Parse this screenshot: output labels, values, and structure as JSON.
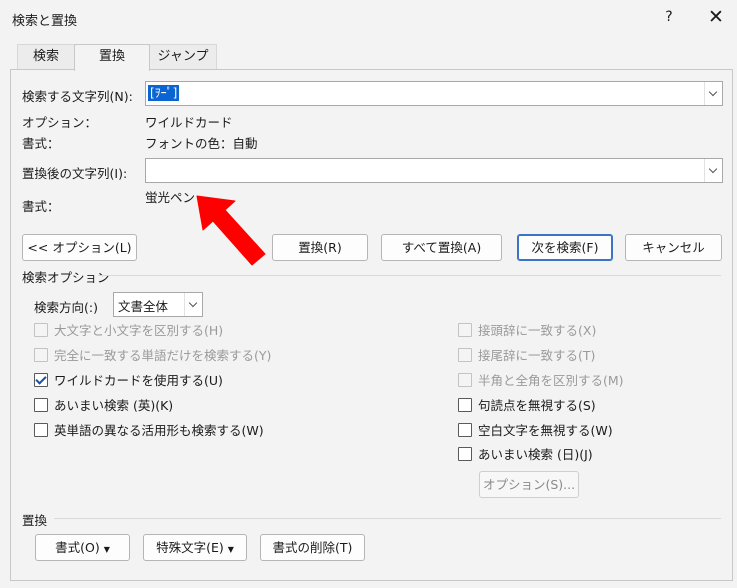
{
  "window": {
    "title": "検索と置換",
    "help_label": "?",
    "close_label": "✕"
  },
  "tabs": [
    {
      "label": "検索"
    },
    {
      "label": "置換"
    },
    {
      "label": "ジャンプ"
    }
  ],
  "find": {
    "label": "検索する文字列(N):",
    "value": "[ｦｰﾟ]",
    "options_label": "オプション：",
    "options_value": "ワイルドカード",
    "format_label": "書式：",
    "format_value": "フォントの色：自動"
  },
  "replace": {
    "label": "置換後の文字列(I):",
    "value": "",
    "format_label": "書式：",
    "format_value": "蛍光ペン"
  },
  "buttons": {
    "less_options": "<< オプション(L)",
    "replace": "置換(R)",
    "replace_all": "すべて置換(A)",
    "find_next": "次を検索(F)",
    "cancel": "キャンセル"
  },
  "search_options": {
    "section_label": "検索オプション",
    "direction_label": "検索方向(:)",
    "direction_value": "文書全体",
    "left": [
      {
        "label": "大文字と小文字を区別する(H)",
        "checked": false,
        "disabled": true
      },
      {
        "label": "完全に一致する単語だけを検索する(Y)",
        "checked": false,
        "disabled": true
      },
      {
        "label": "ワイルドカードを使用する(U)",
        "checked": true,
        "disabled": false
      },
      {
        "label": "あいまい検索 (英)(K)",
        "checked": false,
        "disabled": false
      },
      {
        "label": "英単語の異なる活用形も検索する(W)",
        "checked": false,
        "disabled": false
      }
    ],
    "right": [
      {
        "label": "接頭辞に一致する(X)",
        "checked": false,
        "disabled": true
      },
      {
        "label": "接尾辞に一致する(T)",
        "checked": false,
        "disabled": true
      },
      {
        "label": "半角と全角を区別する(M)",
        "checked": false,
        "disabled": true
      },
      {
        "label": "句読点を無視する(S)",
        "checked": false,
        "disabled": false
      },
      {
        "label": "空白文字を無視する(W)",
        "checked": false,
        "disabled": false
      },
      {
        "label": "あいまい検索 (日)(J)",
        "checked": false,
        "disabled": false
      }
    ],
    "options_button": "オプション(S)..."
  },
  "replace_section": {
    "label": "置換",
    "format_button": "書式(O)",
    "special_button": "特殊文字(E)",
    "clear_format_button": "書式の削除(T)"
  },
  "annotation": {
    "arrow_color": "#ff0000"
  }
}
